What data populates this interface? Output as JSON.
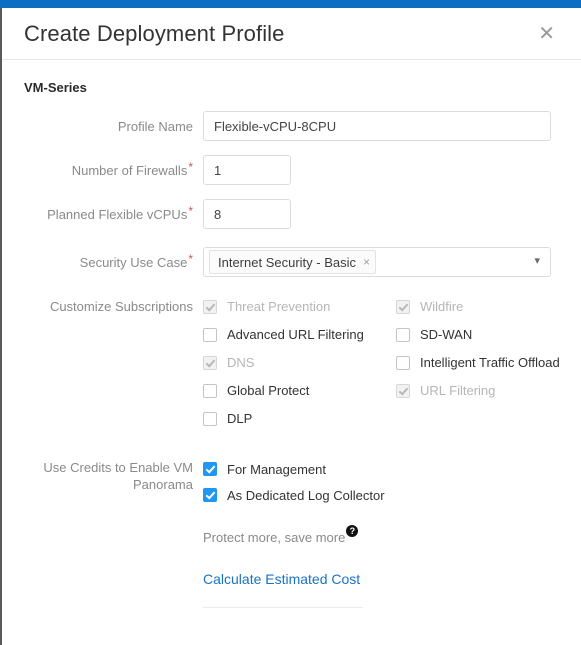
{
  "modal": {
    "title": "Create Deployment Profile",
    "close_icon": "close-icon",
    "section_title": "VM-Series"
  },
  "fields": {
    "profile_name": {
      "label": "Profile Name",
      "required": false,
      "value": "Flexible-vCPU-8CPU",
      "placeholder": ""
    },
    "number_of_firewalls": {
      "label": "Number of Firewalls",
      "required": true,
      "required_marker": "*",
      "value": "1",
      "placeholder": ""
    },
    "planned_flexible_vcpus": {
      "label": "Planned Flexible vCPUs",
      "required": true,
      "required_marker": "*",
      "value": "8",
      "placeholder": ""
    },
    "security_use_case": {
      "label": "Security Use Case",
      "required": true,
      "required_marker": "*",
      "selected_tag": "Internet Security - Basic",
      "tag_remove_icon": "×",
      "dropdown_icon": "chevron-down-icon"
    }
  },
  "subscriptions": {
    "label": "Customize Subscriptions",
    "items": [
      {
        "label": "Threat Prevention",
        "checked": true,
        "disabled": true,
        "column": "left"
      },
      {
        "label": "Wildfire",
        "checked": true,
        "disabled": true,
        "column": "right"
      },
      {
        "label": "Advanced URL Filtering",
        "checked": false,
        "disabled": false,
        "column": "left"
      },
      {
        "label": "SD-WAN",
        "checked": false,
        "disabled": false,
        "column": "right"
      },
      {
        "label": "DNS",
        "checked": true,
        "disabled": true,
        "column": "left"
      },
      {
        "label": "Intelligent Traffic Offload",
        "checked": false,
        "disabled": false,
        "column": "right"
      },
      {
        "label": "Global Protect",
        "checked": false,
        "disabled": false,
        "column": "left"
      },
      {
        "label": "URL Filtering",
        "checked": true,
        "disabled": true,
        "column": "right"
      },
      {
        "label": "DLP",
        "checked": false,
        "disabled": false,
        "column": "left"
      }
    ]
  },
  "credits": {
    "label": "Use Credits to Enable VM Panorama",
    "items": [
      {
        "label": "For Management",
        "checked": true,
        "disabled": false
      },
      {
        "label": "As Dedicated Log Collector",
        "checked": true,
        "disabled": false
      }
    ]
  },
  "footer": {
    "protect_text": "Protect more, save more",
    "help_icon": "?",
    "calculate_link": "Calculate Estimated Cost"
  },
  "colors": {
    "top_bar": "#0a6fc2",
    "accent_checkbox": "#2196f3",
    "link": "#1a73c4",
    "required_asterisk": "#d9534f",
    "label_text": "#8a8a8a"
  }
}
